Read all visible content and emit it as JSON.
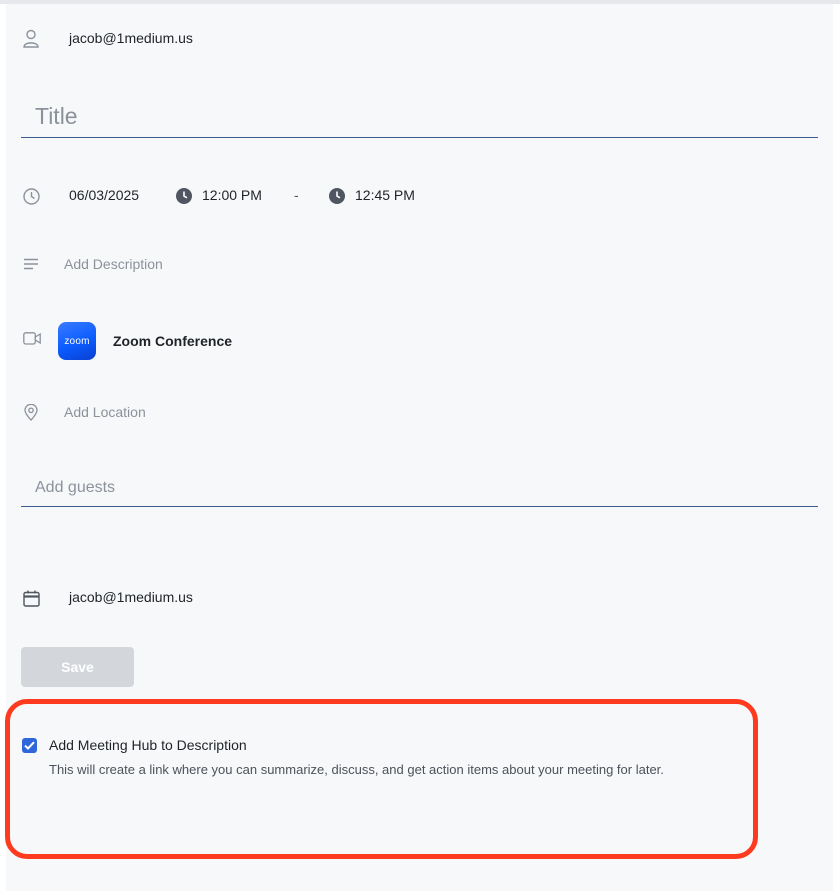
{
  "organizer": {
    "email": "jacob@1medium.us"
  },
  "title_field": {
    "placeholder": "Title",
    "value": ""
  },
  "datetime": {
    "date": "06/03/2025",
    "start_time": "12:00 PM",
    "separator": "-",
    "end_time": "12:45 PM"
  },
  "description_field": {
    "placeholder": "Add Description"
  },
  "conference": {
    "logo_text": "zoom",
    "label": "Zoom Conference"
  },
  "location_field": {
    "placeholder": "Add Location"
  },
  "guests_field": {
    "placeholder": "Add guests",
    "value": ""
  },
  "calendar": {
    "email": "jacob@1medium.us"
  },
  "save_button": {
    "label": "Save"
  },
  "meeting_hub": {
    "checked": true,
    "label": "Add Meeting Hub to Description",
    "description": "This will create a link where you can summarize, discuss, and get action items about your meeting for later."
  },
  "icons": {
    "organizer": "person-icon",
    "date": "clock-outline-icon",
    "start": "clock-filled-icon",
    "end": "clock-filled-icon",
    "description": "lines-icon",
    "conference": "video-camera-icon",
    "location": "map-pin-icon",
    "calendar": "calendar-icon",
    "checkbox": "checkmark-icon"
  },
  "colors": {
    "accent": "#2f66d9",
    "underline": "#3d5b8f",
    "highlight": "#ff3b1f",
    "zoom": "#0b5cff",
    "save_disabled": "#d3d7dc"
  }
}
